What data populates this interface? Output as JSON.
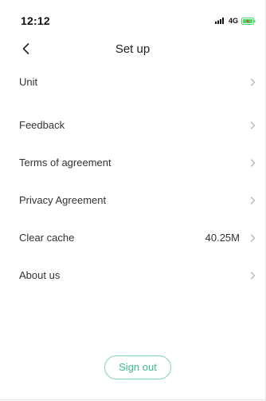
{
  "status_bar": {
    "time": "12:12",
    "network": "4G",
    "battery_color": "#4cd964"
  },
  "header": {
    "title": "Set up",
    "back_icon": "chevron-left-icon"
  },
  "settings": {
    "items": [
      {
        "label": "Unit",
        "value": ""
      },
      {
        "label": "Feedback",
        "value": ""
      },
      {
        "label": "Terms of agreement",
        "value": ""
      },
      {
        "label": "Privacy Agreement",
        "value": ""
      },
      {
        "label": "Clear cache",
        "value": "40.25M"
      },
      {
        "label": "About us",
        "value": ""
      }
    ],
    "chevron_icon": "chevron-right-icon"
  },
  "footer": {
    "sign_out_label": "Sign out",
    "accent_color": "#3fb892"
  }
}
